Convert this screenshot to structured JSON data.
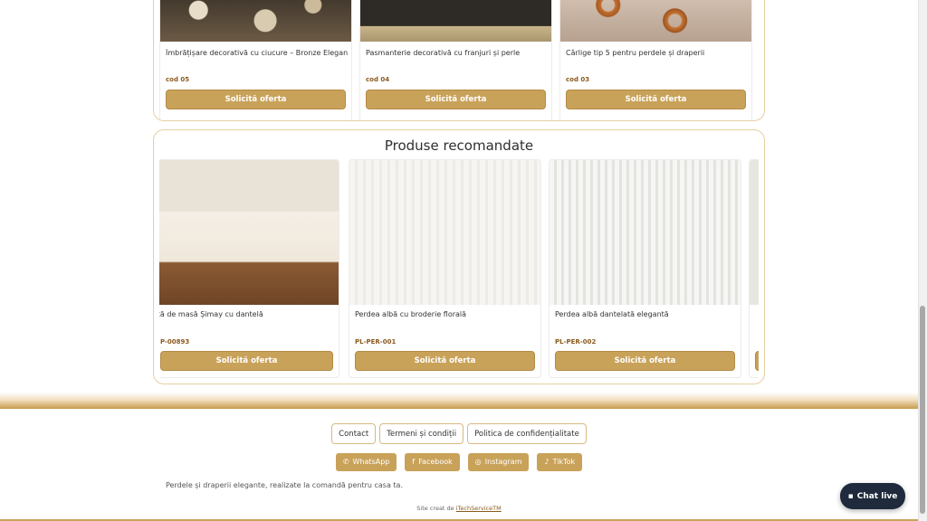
{
  "top_section": {
    "products": [
      {
        "name": "Îmbrățișare decorativă cu ciucure – Bronze Elegance",
        "code": "cod 05",
        "button": "Solicită oferta"
      },
      {
        "name": "Pasmanterie decorativă cu franjuri și perle",
        "code": "cod 04",
        "button": "Solicită oferta"
      },
      {
        "name": "Cârlige tip 5 pentru perdele și draperii",
        "code": "cod 03",
        "button": "Solicită oferta"
      }
    ]
  },
  "recommended": {
    "title": "Produse recomandate",
    "products": [
      {
        "name": "Față de masă Șimay cu dantelă",
        "code": "P-00893",
        "button": "Solicită oferta"
      },
      {
        "name": "Perdea albă cu broderie florală",
        "code": "PL-PER-001",
        "button": "Solicită oferta"
      },
      {
        "name": "Perdea albă dantelată elegantă",
        "code": "PL-PER-002",
        "button": "Solicită oferta"
      }
    ]
  },
  "footer": {
    "links": [
      "Contact",
      "Termeni și condiții",
      "Politica de confidențialitate"
    ],
    "socials": [
      {
        "label": "WhatsApp",
        "icon": "whatsapp-icon"
      },
      {
        "label": "Facebook",
        "icon": "facebook-icon"
      },
      {
        "label": "Instagram",
        "icon": "instagram-icon"
      },
      {
        "label": "TikTok",
        "icon": "tiktok-icon"
      }
    ],
    "tagline": "Perdele și draperii elegante, realizate la comandă pentru casa ta.",
    "credit_prefix": "Site creat de ",
    "credit_link": "iTechServiceTM"
  },
  "chat": {
    "label": "Chat live",
    "icon": "chat-bubble-icon"
  },
  "colors": {
    "accent": "#c9a25a",
    "accent_border": "#e6cfa2",
    "chat_bg": "#1f2a3c"
  }
}
